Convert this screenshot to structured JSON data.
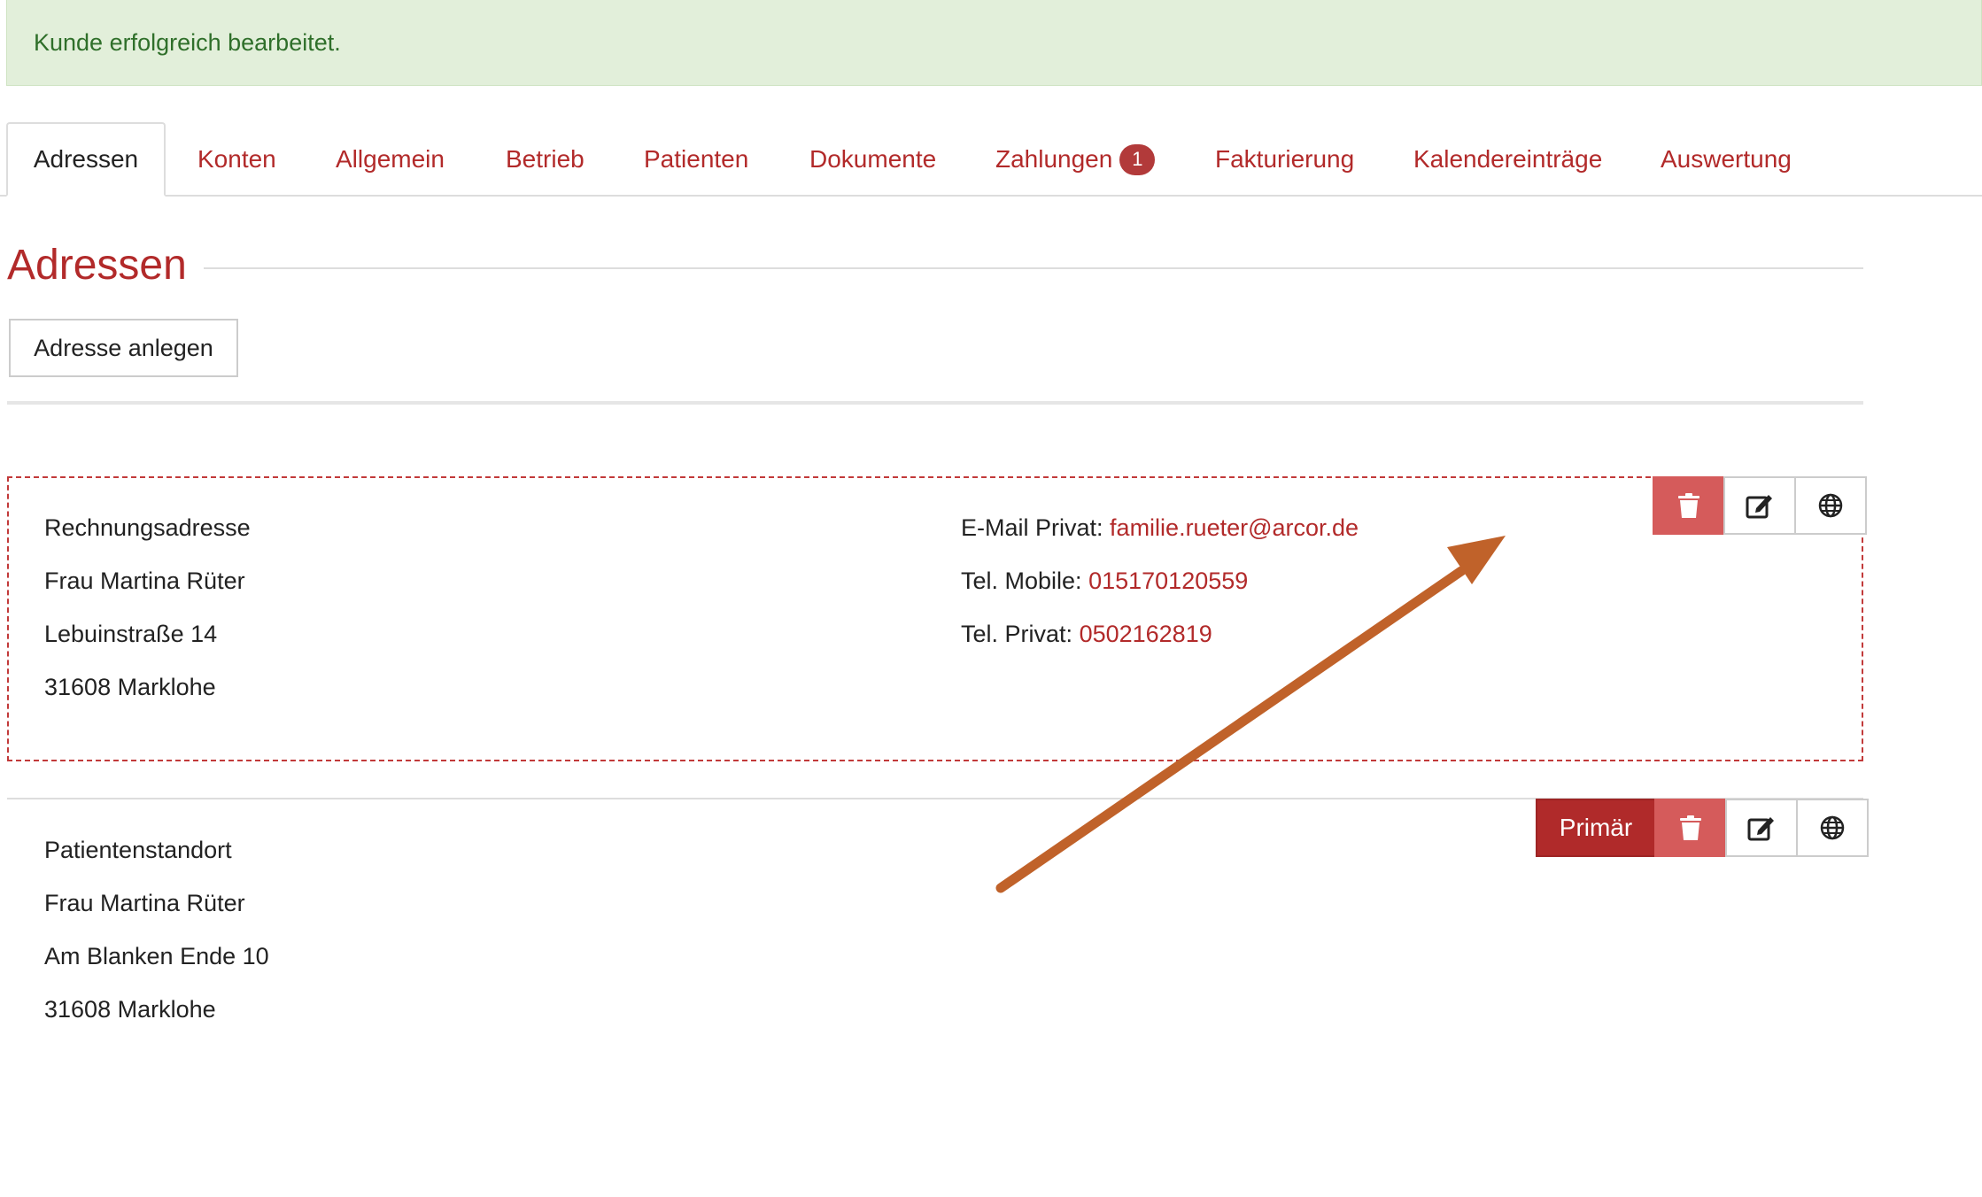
{
  "alert": {
    "message": "Kunde erfolgreich bearbeitet."
  },
  "tabs": [
    {
      "label": "Adressen",
      "active": true
    },
    {
      "label": "Konten"
    },
    {
      "label": "Allgemein"
    },
    {
      "label": "Betrieb"
    },
    {
      "label": "Patienten"
    },
    {
      "label": "Dokumente"
    },
    {
      "label": "Zahlungen",
      "badge": "1"
    },
    {
      "label": "Fakturierung"
    },
    {
      "label": "Kalendereinträge"
    },
    {
      "label": "Auswertung"
    }
  ],
  "page": {
    "title": "Adressen",
    "add_button": "Adresse anlegen"
  },
  "addresses": [
    {
      "type": "Rechnungsadresse",
      "name": "Frau Martina Rüter",
      "street": "Lebuinstraße 14",
      "city": "31608 Marklohe",
      "contacts": [
        {
          "label": "E-Mail Privat:",
          "value": "familie.rueter@arcor.de"
        },
        {
          "label": "Tel. Mobile:",
          "value": "015170120559"
        },
        {
          "label": "Tel. Privat:",
          "value": "0502162819"
        }
      ],
      "actions": [
        "trash-icon",
        "edit-icon",
        "globe-icon"
      ]
    },
    {
      "type": "Patientenstandort",
      "name": "Frau Martina Rüter",
      "street": "Am Blanken Ende 10",
      "city": "31608 Marklohe",
      "primary_label": "Primär",
      "actions": [
        "trash-icon",
        "edit-icon",
        "globe-icon"
      ]
    }
  ],
  "colors": {
    "accent": "#b22a2a",
    "success_bg": "#e2efda",
    "danger": "#d55b5b",
    "annotation_arrow": "#c0622a"
  }
}
